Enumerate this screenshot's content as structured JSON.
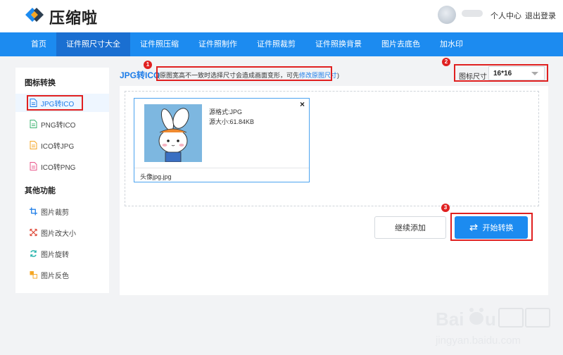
{
  "header": {
    "brand": "压缩啦",
    "user_center": "个人中心",
    "logout": "退出登录"
  },
  "nav": {
    "items": [
      "首页",
      "证件照尺寸大全",
      "证件照压缩",
      "证件照制作",
      "证件照裁剪",
      "证件照换背景",
      "图片去底色",
      "加水印"
    ],
    "active_index": 1
  },
  "sidebar": {
    "section1_title": "图标转换",
    "section1_items": [
      "JPG转ICO",
      "PNG转ICO",
      "ICO转JPG",
      "ICO转PNG"
    ],
    "section2_title": "其他功能",
    "section2_items": [
      "图片裁剪",
      "图片改大小",
      "图片旋转",
      "图片反色"
    ]
  },
  "main": {
    "title": "JPG转ICO",
    "notice_prefix": "(原图宽高不一致时选择尺寸会造成画面变形，可先",
    "notice_link": "修改原图尺寸",
    "notice_suffix": ")",
    "size_label": "图标尺寸",
    "size_value": "16*16"
  },
  "file": {
    "format_label": "源格式:JPG",
    "size_label": "源大小:61.84KB",
    "name": "头像jpg.jpg",
    "close": "×"
  },
  "buttons": {
    "add_more": "继续添加",
    "start": "开始转换"
  },
  "badges": [
    "1",
    "2",
    "3"
  ],
  "colors": {
    "primary": "#1c8bf0",
    "nav_active": "#1a6fd1",
    "highlight_red": "#e02020"
  }
}
